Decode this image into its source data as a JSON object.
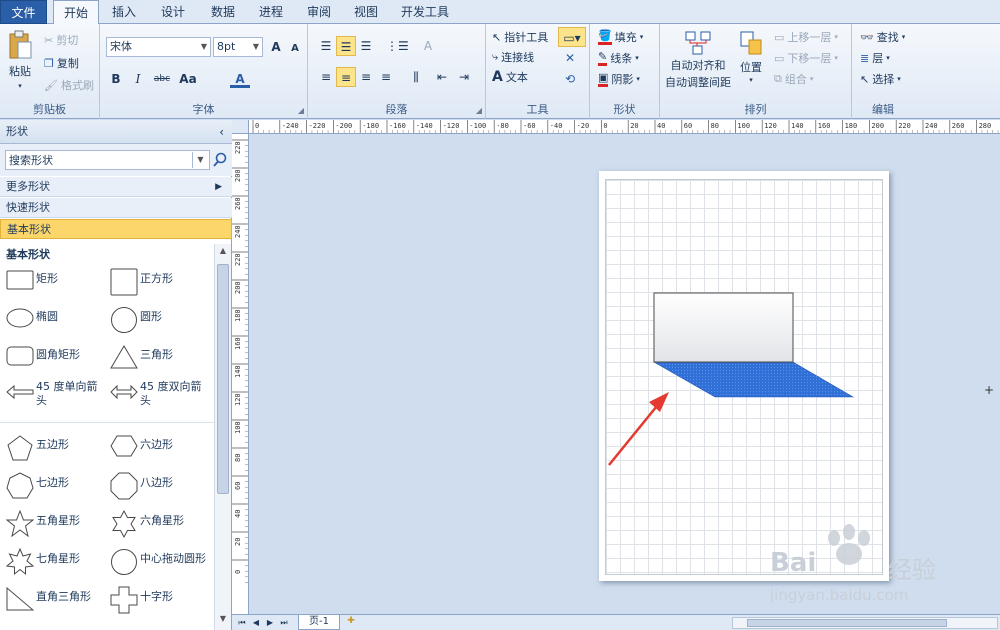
{
  "tabs": {
    "file": "文件",
    "home": "开始",
    "insert": "插入",
    "design": "设计",
    "data": "数据",
    "process": "进程",
    "review": "审阅",
    "view": "视图",
    "developer": "开发工具"
  },
  "clipboard": {
    "paste": "粘贴",
    "cut": "剪切",
    "copy": "复制",
    "format_painter": "格式刷",
    "label": "剪贴板"
  },
  "font": {
    "name": "宋体",
    "size": "8pt",
    "grow": "A",
    "shrink": "A",
    "bold": "B",
    "italic": "I",
    "strike": "abc",
    "case": "Aa",
    "color": "A",
    "label": "字体"
  },
  "paragraph": {
    "label": "段落"
  },
  "tools": {
    "pointer": "指针工具",
    "connector": "连接线",
    "text": "文本",
    "label": "工具"
  },
  "shape_style": {
    "fill": "填充",
    "line": "线条",
    "shadow": "阴影",
    "label": "形状"
  },
  "arrange": {
    "auto_align_1": "自动对齐和",
    "auto_align_2": "自动调整间距",
    "position": "位置",
    "bring_forward": "上移一层",
    "send_backward": "下移一层",
    "group": "组合",
    "label": "排列"
  },
  "editing": {
    "find": "查找",
    "layer": "层",
    "select": "选择",
    "label": "编辑"
  },
  "panel": {
    "title": "形状",
    "search_placeholder": "搜索形状",
    "more_shapes": "更多形状",
    "quick_shapes": "快速形状",
    "basic_shapes": "基本形状",
    "stencil_title": "基本形状",
    "shapes": [
      "矩形",
      "正方形",
      "椭圆",
      "圆形",
      "圆角矩形",
      "三角形",
      "45 度单向箭头",
      "45 度双向箭头",
      "五边形",
      "六边形",
      "七边形",
      "八边形",
      "五角星形",
      "六角星形",
      "七角星形",
      "中心拖动圆形",
      "直角三角形",
      "十字形"
    ]
  },
  "ruler": {
    "h_ticks": [
      "0",
      "-240",
      "-220",
      "-200",
      "-180",
      "-160",
      "-140",
      "-120",
      "-100",
      "-80",
      "-60",
      "-40",
      "-20",
      "0",
      "20",
      "40",
      "60",
      "80",
      "100",
      "120",
      "140",
      "160",
      "180",
      "200",
      "220",
      "240",
      "260",
      "280"
    ],
    "v_ticks": [
      "220",
      "200",
      "260",
      "240",
      "220",
      "200",
      "180",
      "160",
      "140",
      "120",
      "100",
      "80",
      "60",
      "40",
      "20",
      "0"
    ]
  },
  "bottom": {
    "page_tab": "页-1"
  },
  "watermark": {
    "brand": "Bai",
    "brand2": "经验",
    "url": "jingyan.baidu.com"
  },
  "colors": {
    "accent": "#2a5ea8",
    "shadow_fill": "#2f6fd6",
    "arrow": "#e43a2f",
    "selected_category": "#fcd66a"
  }
}
